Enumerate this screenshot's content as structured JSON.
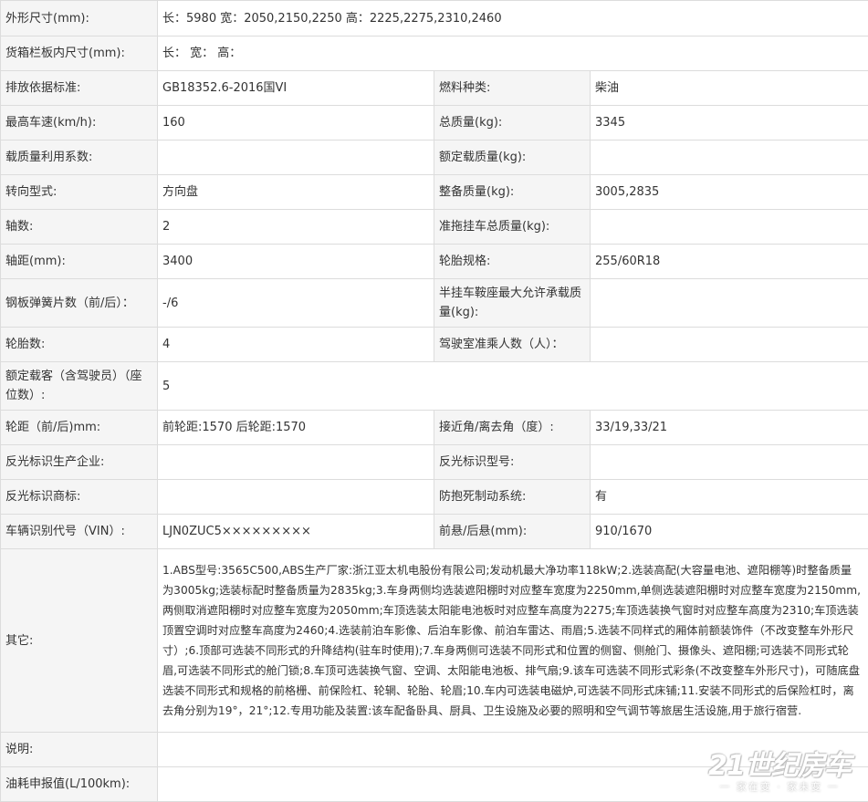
{
  "rows": [
    {
      "label": "外形尺寸(mm):",
      "value": "长：5980 宽：2050,2150,2250 高：2225,2275,2310,2460"
    },
    {
      "label": "货箱栏板内尺寸(mm):",
      "value": "长： 宽： 高："
    },
    {
      "label": "排放依据标准:",
      "value": "GB18352.6-2016国VI",
      "label2": "燃料种类:",
      "value2": "柴油"
    },
    {
      "label": "最高车速(km/h):",
      "value": "160",
      "label2": "总质量(kg):",
      "value2": "3345"
    },
    {
      "label": "载质量利用系数:",
      "value": "",
      "label2": "额定载质量(kg):",
      "value2": ""
    },
    {
      "label": "转向型式:",
      "value": "方向盘",
      "label2": "整备质量(kg):",
      "value2": "3005,2835"
    },
    {
      "label": "轴数:",
      "value": "2",
      "label2": "准拖挂车总质量(kg):",
      "value2": ""
    },
    {
      "label": "轴距(mm):",
      "value": "3400",
      "label2": "轮胎规格:",
      "value2": "255/60R18"
    },
    {
      "label": "钢板弹簧片数（前/后）：",
      "value": "-/6",
      "label2": "半挂车鞍座最大允许承载质量(kg):",
      "value2": ""
    },
    {
      "label": "轮胎数:",
      "value": "4",
      "label2": "驾驶室准乘人数（人）：",
      "value2": ""
    },
    {
      "label": "额定载客（含驾驶员）（座位数）:",
      "value": "5"
    },
    {
      "label": "轮距（前/后)mm:",
      "value": "前轮距:1570 后轮距:1570",
      "label2": "接近角/离去角（度）:",
      "value2": "33/19,33/21"
    },
    {
      "label": "反光标识生产企业:",
      "value": "",
      "label2": "反光标识型号:",
      "value2": ""
    },
    {
      "label": "反光标识商标:",
      "value": "",
      "label2": "防抱死制动系统:",
      "value2": "有"
    },
    {
      "label": "车辆识别代号（VIN）:",
      "value": "LJN0ZUC5×××××××××",
      "label2": "前悬/后悬(mm):",
      "value2": "910/1670"
    },
    {
      "label": "其它:",
      "value": "1.ABS型号:3565C500,ABS生产厂家:浙江亚太机电股份有限公司;发动机最大净功率118kW;2.选装高配(大容量电池、遮阳棚等)时整备质量为3005kg;选装标配时整备质量为2835kg;3.车身两侧均选装遮阳棚时对应整车宽度为2250mm,单侧选装遮阳棚时对应整车宽度为2150mm,两侧取消遮阳棚时对应整车宽度为2050mm;车顶选装太阳能电池板时对应整车高度为2275;车顶选装换气窗时对应整车高度为2310;车顶选装顶置空调时对应整车高度为2460;4.选装前泊车影像、后泊车影像、前泊车雷达、雨眉;5.选装不同样式的厢体前额装饰件（不改变整车外形尺寸）;6.顶部可选装不同形式的升降结构(驻车时使用);7.车身两侧可选装不同形式和位置的侧窗、侧舱门、摄像头、遮阳棚;可选装不同形式轮眉,可选装不同形式的舱门锁;8.车顶可选装换气窗、空调、太阳能电池板、排气扇;9.该车可选装不同形式彩条(不改变整车外形尺寸)，可随底盘选装不同形式和规格的前格栅、前保险杠、轮辋、轮胎、轮眉;10.车内可选装电磁炉,可选装不同形式床铺;11.安装不同形式的后保险杠时，离去角分别为19°，21°;12.专用功能及装置:该车配备卧具、厨具、卫生设施及必要的照明和空气调节等旅居生活设施,用于旅行宿营."
    },
    {
      "label": "说明:",
      "value": ""
    },
    {
      "label": "油耗申报值(L/100km):",
      "value": ""
    }
  ],
  "watermark": {
    "logo": "21世纪房车",
    "slogan": "一 家在变 · 家未变 一"
  }
}
